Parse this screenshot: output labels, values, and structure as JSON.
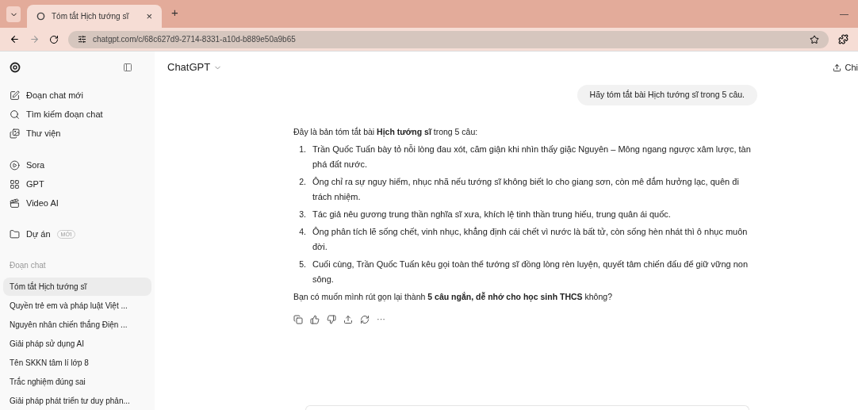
{
  "browser": {
    "tab": {
      "title": "Tóm tắt Hịch tướng sĩ",
      "close": "×",
      "selected": true
    },
    "new_tab": "+",
    "minimize": "—",
    "url": "chatgpt.com/c/68c627d9-2714-8331-a10d-b889e50a9b65"
  },
  "sidebar": {
    "nav": [
      {
        "label": "Đoạn chat mới",
        "kind": "edit"
      },
      {
        "label": "Tìm kiếm đoạn chat",
        "kind": "search"
      },
      {
        "label": "Thư viện",
        "kind": "library"
      }
    ],
    "apps": [
      {
        "label": "Sora",
        "kind": "play"
      },
      {
        "label": "GPT",
        "kind": "grid"
      },
      {
        "label": "Video AI",
        "kind": "video"
      }
    ],
    "projects": {
      "label": "Dự án",
      "badge": "MỚI"
    },
    "chats_heading": "Đoạn chat",
    "chats": [
      {
        "title": "Tóm tắt Hịch tướng sĩ",
        "selected": true
      },
      {
        "title": "Quyền trẻ em và pháp luật Việt ...",
        "selected": false
      },
      {
        "title": "Nguyên nhân chiến thắng Điện ...",
        "selected": false
      },
      {
        "title": "Giải pháp sử dụng AI",
        "selected": false
      },
      {
        "title": "Tên SKKN tâm lí lớp 8",
        "selected": false
      },
      {
        "title": "Trắc nghiệm đúng sai",
        "selected": false
      },
      {
        "title": "Giải pháp phát triển tư duy phản...",
        "selected": false
      }
    ]
  },
  "header": {
    "model": "ChatGPT",
    "share": "Chi"
  },
  "conversation": {
    "user_message": "Hãy tóm tắt bài Hịch tướng sĩ trong 5 câu.",
    "intro": "Đây là bản tóm tắt bài **Hịch tướng sĩ** trong 5 câu:",
    "items": [
      {
        "number": "1.",
        "text": "Trần Quốc Tuấn bày tỏ nỗi lòng đau xót, căm giận khi nhìn thấy giặc Nguyên – Mông ngang ngược xâm lược, tàn phá đất nước."
      },
      {
        "number": "2.",
        "text": "Ông chỉ ra sự nguy hiểm, nhục nhã nếu tướng sĩ không biết lo cho giang sơn, còn mê đắm hưởng lạc, quên đi trách nhiệm."
      },
      {
        "number": "3.",
        "text": "Tác giả nêu gương trung thần nghĩa sĩ xưa, khích lệ tinh thần trung hiếu, trung quân ái quốc."
      },
      {
        "number": "4.",
        "text": "Ông phân tích lẽ sống chết, vinh nhục, khẳng định cái chết vì nước là bất tử, còn sống hèn nhát thì ô nhục muôn đời."
      },
      {
        "number": "5.",
        "text": "Cuối cùng, Trần Quốc Tuấn kêu gọi toàn thể tướng sĩ đồng lòng rèn luyện, quyết tâm chiến đấu để giữ vững non sông."
      }
    ],
    "closing": "Bạn có muốn mình rút gọn lại thành **5 câu ngắn, dễ nhớ cho học sinh THCS** không?",
    "more": "···"
  }
}
